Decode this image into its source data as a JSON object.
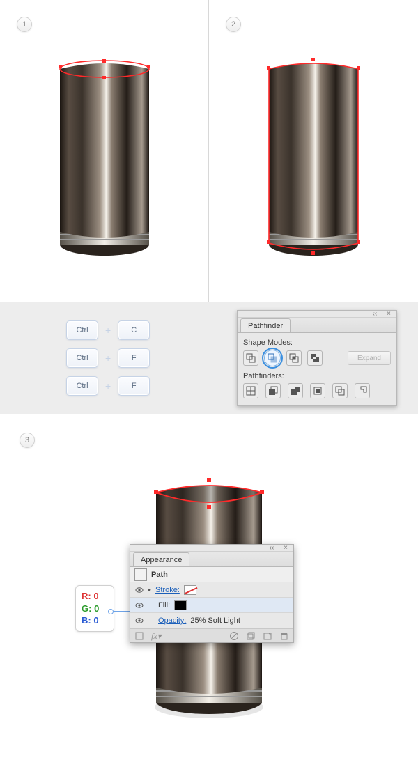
{
  "steps": {
    "s1": "1",
    "s2": "2",
    "s3": "3"
  },
  "shortcuts": {
    "ctrl": "Ctrl",
    "plus": "+",
    "rows": [
      "C",
      "F",
      "F"
    ]
  },
  "pathfinder": {
    "tab": "Pathfinder",
    "shape_modes_label": "Shape Modes:",
    "pathfinders_label": "Pathfinders:",
    "expand": "Expand",
    "close_glyph": "×",
    "chev_glyph": "‹‹"
  },
  "rgb": {
    "r_label": "R:",
    "g_label": "G:",
    "b_label": "B:",
    "r": "0",
    "g": "0",
    "b": "0"
  },
  "appearance": {
    "tab": "Appearance",
    "object_label": "Path",
    "stroke_label": "Stroke:",
    "fill_label": "Fill:",
    "opacity_label": "Opacity:",
    "opacity_value": "25% Soft Light",
    "fx_label": "fx",
    "close_glyph": "×",
    "chev_glyph": "‹‹",
    "arrow_glyph": "▸"
  }
}
